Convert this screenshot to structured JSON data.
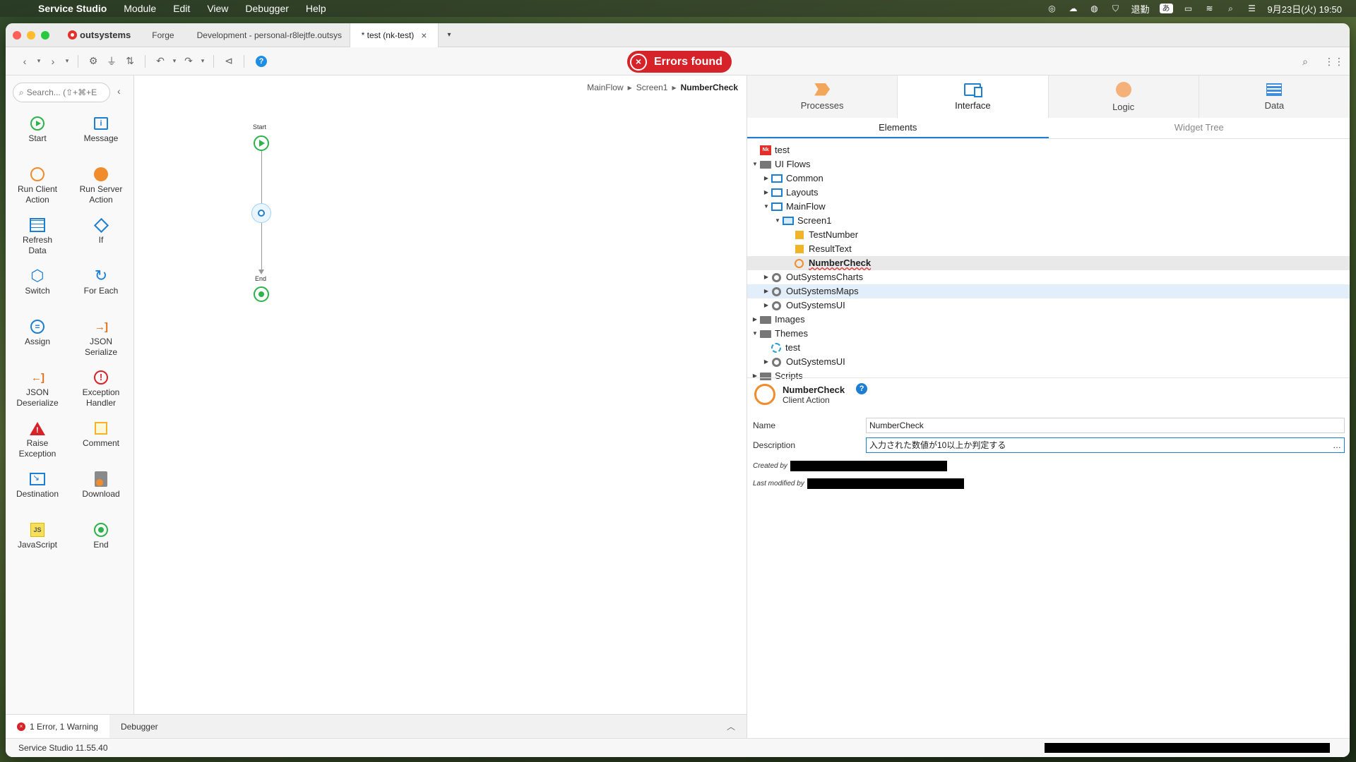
{
  "menubar": {
    "app": "Service Studio",
    "items": [
      "Module",
      "Edit",
      "View",
      "Debugger",
      "Help"
    ],
    "status_text": "退勤",
    "input_mode": "あ",
    "clock": "9月23日(火) 19:50"
  },
  "tabs": {
    "brand": "outsystems",
    "forge": "Forge",
    "development": "Development - personal-r8lejtfe.outsys",
    "active": "* test (nk-test)",
    "close": "×",
    "more": "▾"
  },
  "toolbar": {
    "errors_label": "Errors found"
  },
  "toolbox": {
    "search_placeholder": "Search... (⇧+⌘+E",
    "tools": [
      {
        "name": "start",
        "label": "Start",
        "icon": "start-icon"
      },
      {
        "name": "message",
        "label": "Message",
        "icon": "message-icon"
      },
      {
        "name": "run-client-action",
        "label": "Run Client\nAction",
        "icon": "client-action-icon"
      },
      {
        "name": "run-server-action",
        "label": "Run Server\nAction",
        "icon": "server-action-icon"
      },
      {
        "name": "refresh-data",
        "label": "Refresh\nData",
        "icon": "refresh-data-icon"
      },
      {
        "name": "if",
        "label": "If",
        "icon": "if-icon"
      },
      {
        "name": "switch",
        "label": "Switch",
        "icon": "switch-icon"
      },
      {
        "name": "for-each",
        "label": "For Each",
        "icon": "for-each-icon"
      },
      {
        "name": "assign",
        "label": "Assign",
        "icon": "assign-icon"
      },
      {
        "name": "json-serialize",
        "label": "JSON\nSerialize",
        "icon": "json-serialize-icon"
      },
      {
        "name": "json-deserialize",
        "label": "JSON\nDeserialize",
        "icon": "json-deserialize-icon"
      },
      {
        "name": "exception-handler",
        "label": "Exception\nHandler",
        "icon": "exception-handler-icon"
      },
      {
        "name": "raise-exception",
        "label": "Raise\nException",
        "icon": "raise-exception-icon"
      },
      {
        "name": "comment",
        "label": "Comment",
        "icon": "comment-icon"
      },
      {
        "name": "destination",
        "label": "Destination",
        "icon": "destination-icon"
      },
      {
        "name": "download",
        "label": "Download",
        "icon": "download-icon"
      },
      {
        "name": "javascript",
        "label": "JavaScript",
        "icon": "javascript-icon"
      },
      {
        "name": "end",
        "label": "End",
        "icon": "end-icon"
      }
    ]
  },
  "canvas": {
    "breadcrumb": [
      "MainFlow",
      "Screen1",
      "NumberCheck"
    ],
    "start_label": "Start",
    "end_label": "End"
  },
  "bottom": {
    "errors_tab": "1 Error, 1 Warning",
    "debugger_tab": "Debugger",
    "version": "Service Studio 11.55.40"
  },
  "right_panel": {
    "tabs": [
      "Processes",
      "Interface",
      "Logic",
      "Data"
    ],
    "subtabs": [
      "Elements",
      "Widget Tree"
    ],
    "tree": [
      {
        "label": "test",
        "depth": 0,
        "twisty": "",
        "icon": "module"
      },
      {
        "label": "UI Flows",
        "depth": 0,
        "twisty": "▼",
        "icon": "folder"
      },
      {
        "label": "Common",
        "depth": 1,
        "twisty": "▶",
        "icon": "flow"
      },
      {
        "label": "Layouts",
        "depth": 1,
        "twisty": "▶",
        "icon": "flow"
      },
      {
        "label": "MainFlow",
        "depth": 1,
        "twisty": "▼",
        "icon": "flow"
      },
      {
        "label": "Screen1",
        "depth": 2,
        "twisty": "▼",
        "icon": "screen"
      },
      {
        "label": "TestNumber",
        "depth": 3,
        "twisty": "",
        "icon": "var"
      },
      {
        "label": "ResultText",
        "depth": 3,
        "twisty": "",
        "icon": "var"
      },
      {
        "label": "NumberCheck",
        "depth": 3,
        "twisty": "",
        "icon": "action",
        "selected": true,
        "error": true
      },
      {
        "label": "OutSystemsCharts",
        "depth": 1,
        "twisty": "▶",
        "icon": "dep"
      },
      {
        "label": "OutSystemsMaps",
        "depth": 1,
        "twisty": "▶",
        "icon": "dep",
        "highlight": true
      },
      {
        "label": "OutSystemsUI",
        "depth": 1,
        "twisty": "▶",
        "icon": "dep"
      },
      {
        "label": "Images",
        "depth": 0,
        "twisty": "▶",
        "icon": "folder"
      },
      {
        "label": "Themes",
        "depth": 0,
        "twisty": "▼",
        "icon": "folder"
      },
      {
        "label": "test",
        "depth": 1,
        "twisty": "",
        "icon": "theme"
      },
      {
        "label": "OutSystemsUI",
        "depth": 1,
        "twisty": "▶",
        "icon": "dep"
      },
      {
        "label": "Scripts",
        "depth": 0,
        "twisty": "▶",
        "icon": "folder"
      }
    ],
    "properties": {
      "title": "NumberCheck",
      "type": "Client Action",
      "name_label": "Name",
      "name_value": "NumberCheck",
      "description_label": "Description",
      "description_value": "入力された数値が10以上か判定する",
      "created_by_label": "Created by",
      "modified_by_label": "Last modified by"
    }
  },
  "colors": {
    "error_red": "#d6232a",
    "accent_blue": "#1d7fd4",
    "action_orange": "#f08c2b",
    "flow_green": "#2cb34a"
  }
}
